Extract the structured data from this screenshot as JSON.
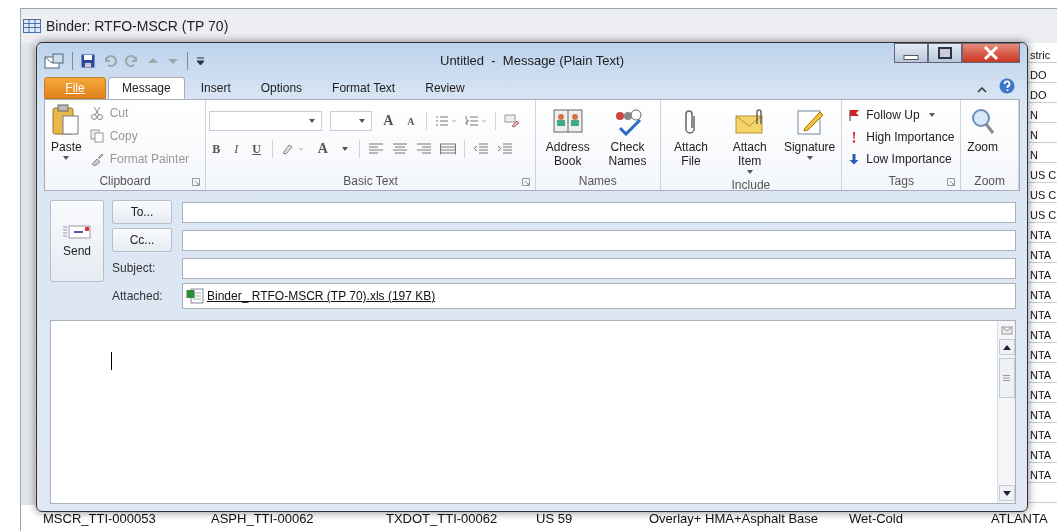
{
  "background_window": {
    "title": "Binder: RTFO-MSCR (TP 70)",
    "right_column": [
      "stric",
      "DO",
      "DO",
      "N",
      "N",
      "N",
      "US C",
      "US C",
      "US C",
      "NTA",
      "NTA",
      "NTA",
      "NTA",
      "NTA",
      "NTA",
      "NTA",
      "NTA",
      "NTA",
      "NTA",
      "NTA",
      "NTA",
      "NTA"
    ],
    "bottom_row": [
      "MSCR_TTI-000053",
      "ASPH_TTI-00062",
      "TXDOT_TTI-00062",
      "US 59",
      "Overlay+ HMA+Asphalt Base",
      "Wet-Cold",
      "ATLANTA"
    ]
  },
  "window": {
    "title": "Untitled  -  Message (Plain Text)"
  },
  "tabs": [
    {
      "label": "File",
      "kind": "file",
      "selected": false
    },
    {
      "label": "Message",
      "kind": "tab",
      "selected": true
    },
    {
      "label": "Insert",
      "kind": "tab",
      "selected": false
    },
    {
      "label": "Options",
      "kind": "tab",
      "selected": false
    },
    {
      "label": "Format Text",
      "kind": "tab",
      "selected": false
    },
    {
      "label": "Review",
      "kind": "tab",
      "selected": false
    }
  ],
  "ribbon": {
    "clipboard": {
      "label": "Clipboard",
      "launcher": true,
      "paste": "Paste",
      "items": [
        {
          "label": "Cut",
          "kind": "cut",
          "disabled": true
        },
        {
          "label": "Copy",
          "kind": "copy",
          "disabled": true
        },
        {
          "label": "Format Painter",
          "kind": "painter",
          "disabled": true
        }
      ]
    },
    "basic_text": {
      "label": "Basic Text",
      "launcher": true,
      "grow_font": "A",
      "shrink_font": "A",
      "bold": "B",
      "italic": "I",
      "underline": "U",
      "font_color": "A"
    },
    "names": {
      "label": "Names",
      "launcher": false,
      "buttons": [
        {
          "label": "Address Book",
          "kind": "book",
          "has_menu": false
        },
        {
          "label": "Check Names",
          "kind": "check",
          "has_menu": false
        }
      ]
    },
    "include": {
      "label": "Include",
      "launcher": false,
      "buttons": [
        {
          "label": "Attach File",
          "kind": "clip",
          "has_menu": false
        },
        {
          "label": "Attach Item",
          "kind": "envelope",
          "has_menu": true
        },
        {
          "label": "Signature",
          "kind": "signature",
          "has_menu": true
        }
      ]
    },
    "tags": {
      "label": "Tags",
      "launcher": true,
      "items": [
        {
          "label": "Follow Up",
          "kind": "flag",
          "has_menu": true
        },
        {
          "label": "High Importance",
          "kind": "high",
          "has_menu": false
        },
        {
          "label": "Low Importance",
          "kind": "low",
          "has_menu": false
        }
      ]
    },
    "zoom": {
      "label": "Zoom",
      "launcher": false,
      "button": "Zoom"
    }
  },
  "header": {
    "send": "Send",
    "fields": [
      {
        "label": "To...",
        "kind": "button"
      },
      {
        "label": "Cc...",
        "kind": "button"
      },
      {
        "label": "Subject:",
        "kind": "label"
      }
    ],
    "attached": {
      "label": "Attached:",
      "file": "Binder_ RTFO-MSCR (TP 70).xls (197 KB)"
    }
  }
}
